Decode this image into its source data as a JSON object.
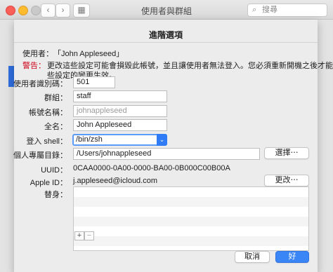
{
  "window": {
    "title": "使用者與群組",
    "back_glyph": "‹",
    "forward_glyph": "›",
    "grid_glyph": "▦",
    "search": {
      "placeholder": "搜尋",
      "icon": "search-icon"
    }
  },
  "sheet": {
    "title": "進階選項",
    "user_label": "使用者：",
    "user_value": "「John Appleseed」",
    "warning_label": "警告：",
    "warning_line1": "更改這些設定可能會損毀此帳號，並且讓使用者無法登入。您必須重新開機之後才能使這",
    "warning_line2": "些設定的變更生效。",
    "fields": {
      "uid_label": "使用者識別碼：",
      "uid_value": "501",
      "group_label": "群組：",
      "group_value": "staff",
      "account_label": "帳號名稱：",
      "account_value": "johnappleseed",
      "fullname_label": "全名：",
      "fullname_value": "John Appleseed",
      "shell_label": "登入 shell：",
      "shell_value": "/bin/zsh",
      "home_label": "個人專屬目錄：",
      "home_value": "/Users/johnappleseed",
      "choose_button": "選擇⋯",
      "uuid_label": "UUID：",
      "uuid_value": "0CAA0000-0A00-0000-BA00-0B000C00B00A",
      "appleid_label": "Apple ID：",
      "appleid_value": "j.appleseed@icloud.com",
      "change_button": "更改⋯",
      "aliases_label": "替身："
    },
    "alias_add": "+",
    "alias_remove": "−",
    "cancel_button": "取消",
    "ok_button": "好"
  },
  "colors": {
    "accent": "#3a86f7",
    "warning": "#d0021b"
  }
}
